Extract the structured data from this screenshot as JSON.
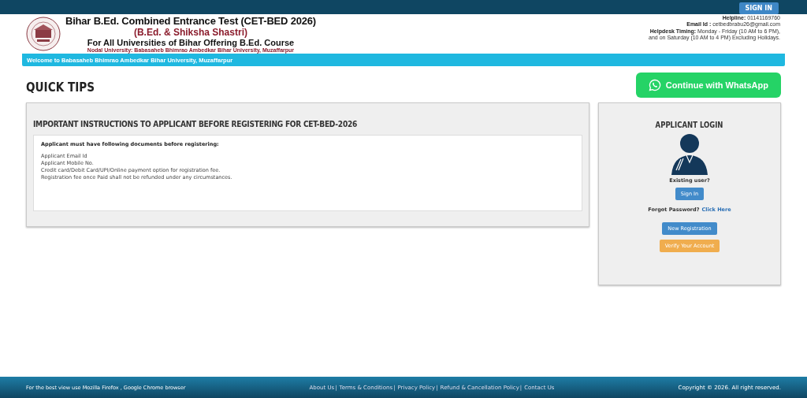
{
  "top_bar": {
    "sign_in": "SIGN IN"
  },
  "header": {
    "title": "Bihar B.Ed. Combined Entrance Test (CET-BED 2026)",
    "subtitle": "(B.Ed. & Shiksha Shastri)",
    "tagline": "For All Universities of Bihar Offering B.Ed. Course",
    "nodal": "Nodal University: Babasaheb Bhimrao Ambedkar Bihar University, Muzaffarpur",
    "contact": [
      {
        "label": "Helpline:",
        "value": "01141169760"
      },
      {
        "label": "Email Id :",
        "value": "cetbedbrabu26@gmail.com"
      },
      {
        "label": "Helpdesk Timing:",
        "value": "Monday - Friday (10 AM to 6 PM),"
      },
      {
        "value": "and on Saturday (10 AM to 4 PM) Excluding Holidays."
      }
    ]
  },
  "welcome_bar": "Welcome to Babasaheb Bhimrao Ambedkar Bihar University, Muzaffarpur",
  "page_title": "QUICK TIPS",
  "whatsapp_button": "Continue with WhatsApp",
  "instructions": {
    "title": "IMPORTANT INSTRUCTIONS TO APPLICANT BEFORE REGISTERING FOR CET-BED-2026",
    "lead": "Applicant must have following documents before registering:",
    "items": [
      "Applicant Email Id",
      "Applicant Mobile No.",
      "Credit card/Debit Card/UPI/Online payment option for registration fee.",
      "Registration fee once Paid shall not be refunded under any circumstances."
    ]
  },
  "login": {
    "title": "APPLICANT LOGIN",
    "existing": "Existing user?",
    "sign_in": "Sign In",
    "forgot": "Forgot Password?",
    "click_here": "Click Here",
    "buttons": [
      {
        "label": "New Registration",
        "kind": "primary"
      },
      {
        "label": "Verify Your Account",
        "kind": "warning"
      }
    ]
  },
  "footer": {
    "note": "For the best view use Mozilla Firefox , Google Chrome browser",
    "separator": "|",
    "links": [
      "About Us",
      "Terms & Conditions",
      "Privacy Policy",
      "Refund & Cancellation Policy",
      "Contact Us"
    ],
    "copyright": "Copyright © 2026. All right reserved."
  }
}
